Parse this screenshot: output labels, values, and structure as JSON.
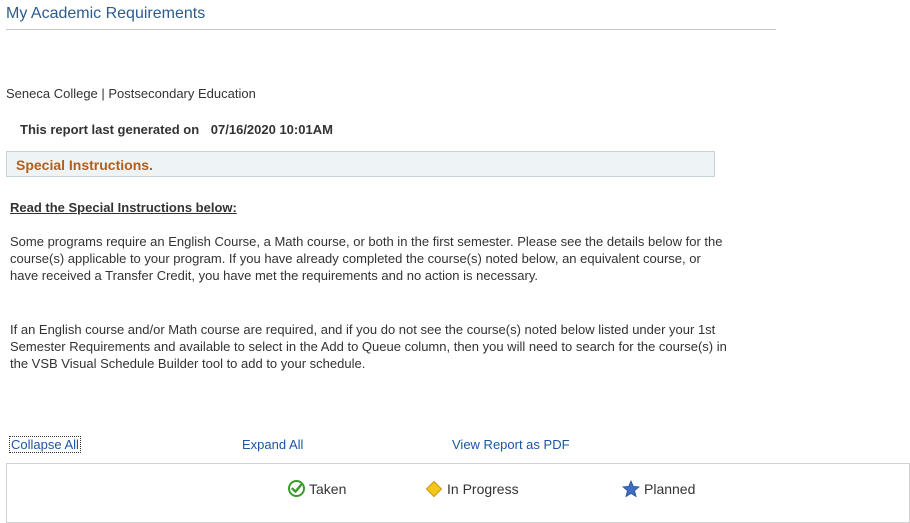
{
  "page": {
    "title": "My Academic Requirements",
    "institution": "Seneca College | Postsecondary Education",
    "report_generated_label": "This report last generated on",
    "report_generated_date": "07/16/2020 10:01AM"
  },
  "special_instructions": {
    "header": "Special Instructions.",
    "read_heading": "Read the Special Instructions below:",
    "paragraph1": "Some programs require an English Course, a Math course, or both in the first semester. Please see the details below for the course(s) applicable to your program. If you have already completed the course(s) noted below, an equivalent course, or have received a Transfer Credit, you have met the requirements and no action is necessary.",
    "paragraph2": "If an English course and/or Math course are required, and if you do not see the course(s) noted below listed under your 1st Semester Requirements and available to select in the Add to Queue column, then you will need to search for the course(s) in the VSB Visual Schedule Builder tool to add to your schedule."
  },
  "actions": {
    "collapse_all": "Collapse All",
    "expand_all": "Expand All",
    "view_pdf": "View Report as PDF"
  },
  "legend": {
    "items": [
      {
        "label": "Taken",
        "icon": "check-circle-icon",
        "color": "#3a9a2e"
      },
      {
        "label": "In Progress",
        "icon": "diamond-icon",
        "color": "#f5c518"
      },
      {
        "label": "Planned",
        "icon": "star-icon",
        "color": "#3c6cc4"
      }
    ]
  },
  "colors": {
    "title": "#2c5c8f",
    "link": "#1c54a6",
    "special_header": "#b45e1a",
    "special_box_bg": "#eef3f5"
  }
}
